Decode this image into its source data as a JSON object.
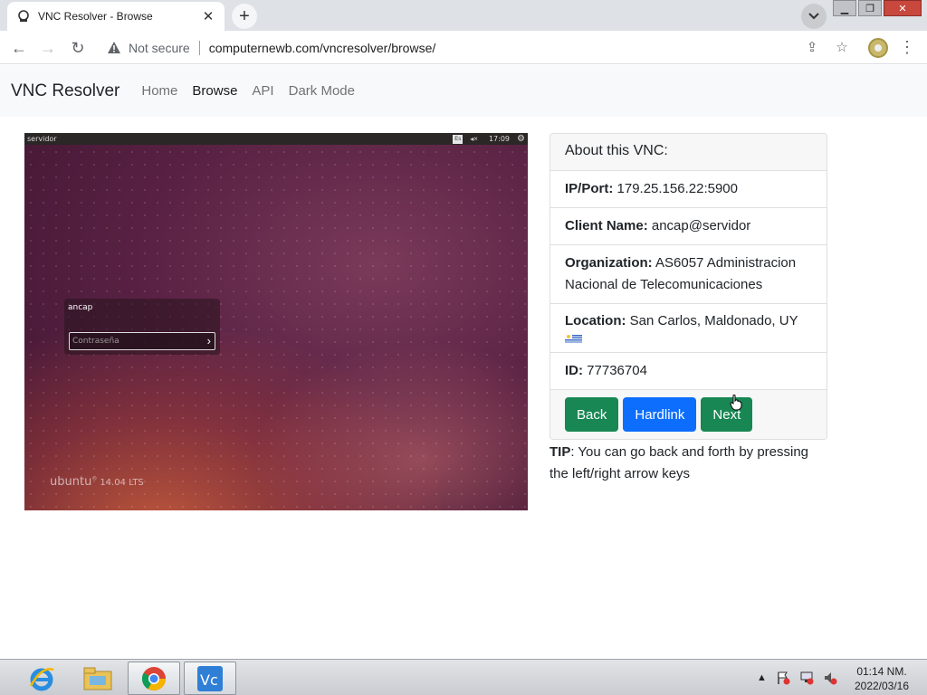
{
  "browser": {
    "tab_title": "VNC Resolver - Browse",
    "security_label": "Not secure",
    "url": "computernewb.com/vncresolver/browse/"
  },
  "navbar": {
    "brand": "VNC Resolver",
    "links": [
      {
        "label": "Home",
        "active": false
      },
      {
        "label": "Browse",
        "active": true
      },
      {
        "label": "API",
        "active": false
      },
      {
        "label": "Dark Mode",
        "active": false
      }
    ]
  },
  "screenshot": {
    "hostname": "servidor",
    "keyboard_layout": "Es",
    "time": "17:09",
    "login_user": "ancap",
    "password_placeholder": "Contraseña",
    "os_name": "ubuntu",
    "os_version": "14.04 LTS"
  },
  "card": {
    "header": "About this VNC:",
    "ip_label": "IP/Port:",
    "ip_value": "179.25.156.22:5900",
    "client_label": "Client Name:",
    "client_value": "ancap@servidor",
    "org_label": "Organization:",
    "org_value": "AS6057 Administracion Nacional de Telecomunicaciones",
    "location_label": "Location:",
    "location_value": "San Carlos, Maldonado, UY",
    "id_label": "ID:",
    "id_value": "77736704",
    "buttons": {
      "back": "Back",
      "hardlink": "Hardlink",
      "next": "Next"
    }
  },
  "tip": {
    "label": "TIP",
    "text": ": You can go back and forth by pressing the left/right arrow keys"
  },
  "taskbar": {
    "time": "01:14 NM.",
    "date": "2022/03/16"
  },
  "colors": {
    "btn_green": "#198754",
    "btn_blue": "#0d6efd",
    "navbar_bg": "#f8f9fa"
  }
}
